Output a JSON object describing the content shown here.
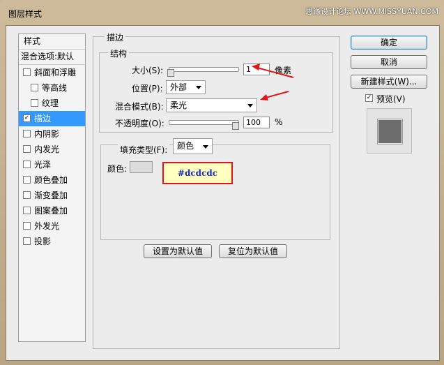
{
  "window": {
    "title": "图层样式",
    "watermark": "思缘设计论坛 WWW.MISSYUAN.COM",
    "accent_color": "#e3131a"
  },
  "style_list": {
    "header": "样式",
    "blend_options": "混合选项:默认",
    "items": [
      {
        "label": "斜面和浮雕",
        "checked": false,
        "sub": false
      },
      {
        "label": "等高线",
        "checked": false,
        "sub": true
      },
      {
        "label": "纹理",
        "checked": false,
        "sub": true
      },
      {
        "label": "描边",
        "checked": true,
        "sub": false,
        "selected": true
      },
      {
        "label": "内阴影",
        "checked": false,
        "sub": false
      },
      {
        "label": "内发光",
        "checked": false,
        "sub": false
      },
      {
        "label": "光泽",
        "checked": false,
        "sub": false
      },
      {
        "label": "颜色叠加",
        "checked": false,
        "sub": false
      },
      {
        "label": "渐变叠加",
        "checked": false,
        "sub": false
      },
      {
        "label": "图案叠加",
        "checked": false,
        "sub": false
      },
      {
        "label": "外发光",
        "checked": false,
        "sub": false
      },
      {
        "label": "投影",
        "checked": false,
        "sub": false
      }
    ]
  },
  "stroke": {
    "group_title": "描边",
    "structure_title": "结构",
    "size_label": "大小(S):",
    "size_value": "1",
    "size_unit": "像素",
    "position_label": "位置(P):",
    "position_value": "外部",
    "blend_label": "混合模式(B):",
    "blend_value": "柔光",
    "opacity_label": "不透明度(O):",
    "opacity_value": "100",
    "opacity_unit": "%",
    "fill_type_label": "填充类型(F):",
    "fill_type_value": "颜色",
    "color_label": "颜色:",
    "color_value": "#dcdcdc",
    "color_annotation": "#dcdcdc",
    "set_default_button": "设置为默认值",
    "reset_default_button": "复位为默认值"
  },
  "side": {
    "ok_button": "确定",
    "cancel_button": "取消",
    "new_style_button": "新建样式(W)...",
    "preview_label": "预览(V)",
    "preview_checked": true
  }
}
